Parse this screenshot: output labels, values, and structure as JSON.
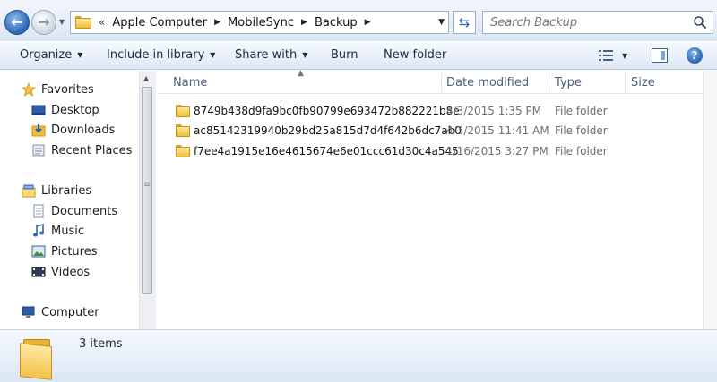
{
  "address": {
    "breadcrumbs": [
      "Apple Computer",
      "MobileSync",
      "Backup"
    ],
    "search_placeholder": "Search Backup"
  },
  "toolbar": {
    "organize": "Organize",
    "include_in_library": "Include in library",
    "share_with": "Share with",
    "burn": "Burn",
    "new_folder": "New folder"
  },
  "nav": {
    "favorites": {
      "label": "Favorites",
      "items": [
        "Desktop",
        "Downloads",
        "Recent Places"
      ]
    },
    "libraries": {
      "label": "Libraries",
      "items": [
        "Documents",
        "Music",
        "Pictures",
        "Videos"
      ]
    },
    "computer": {
      "label": "Computer"
    }
  },
  "columns": {
    "name": "Name",
    "date_modified": "Date modified",
    "type": "Type",
    "size": "Size"
  },
  "files": [
    {
      "name": "8749b438d9fa9bc0fb90799e693472b882221b8e",
      "date": "4/3/2015 1:35 PM",
      "type": "File folder"
    },
    {
      "name": "ac85142319940b29bd25a815d7d4f642b6dc7ab0",
      "date": "4/3/2015 11:41 AM",
      "type": "File folder"
    },
    {
      "name": "f7ee4a1915e16e4615674e6e01ccc61d30c4a545",
      "date": "1/16/2015 3:27 PM",
      "type": "File folder"
    }
  ],
  "status": {
    "item_count": "3 items"
  },
  "colors": {
    "accent": "#2a66b6",
    "folder": "#f1be3b",
    "header_text": "#4c607a"
  }
}
